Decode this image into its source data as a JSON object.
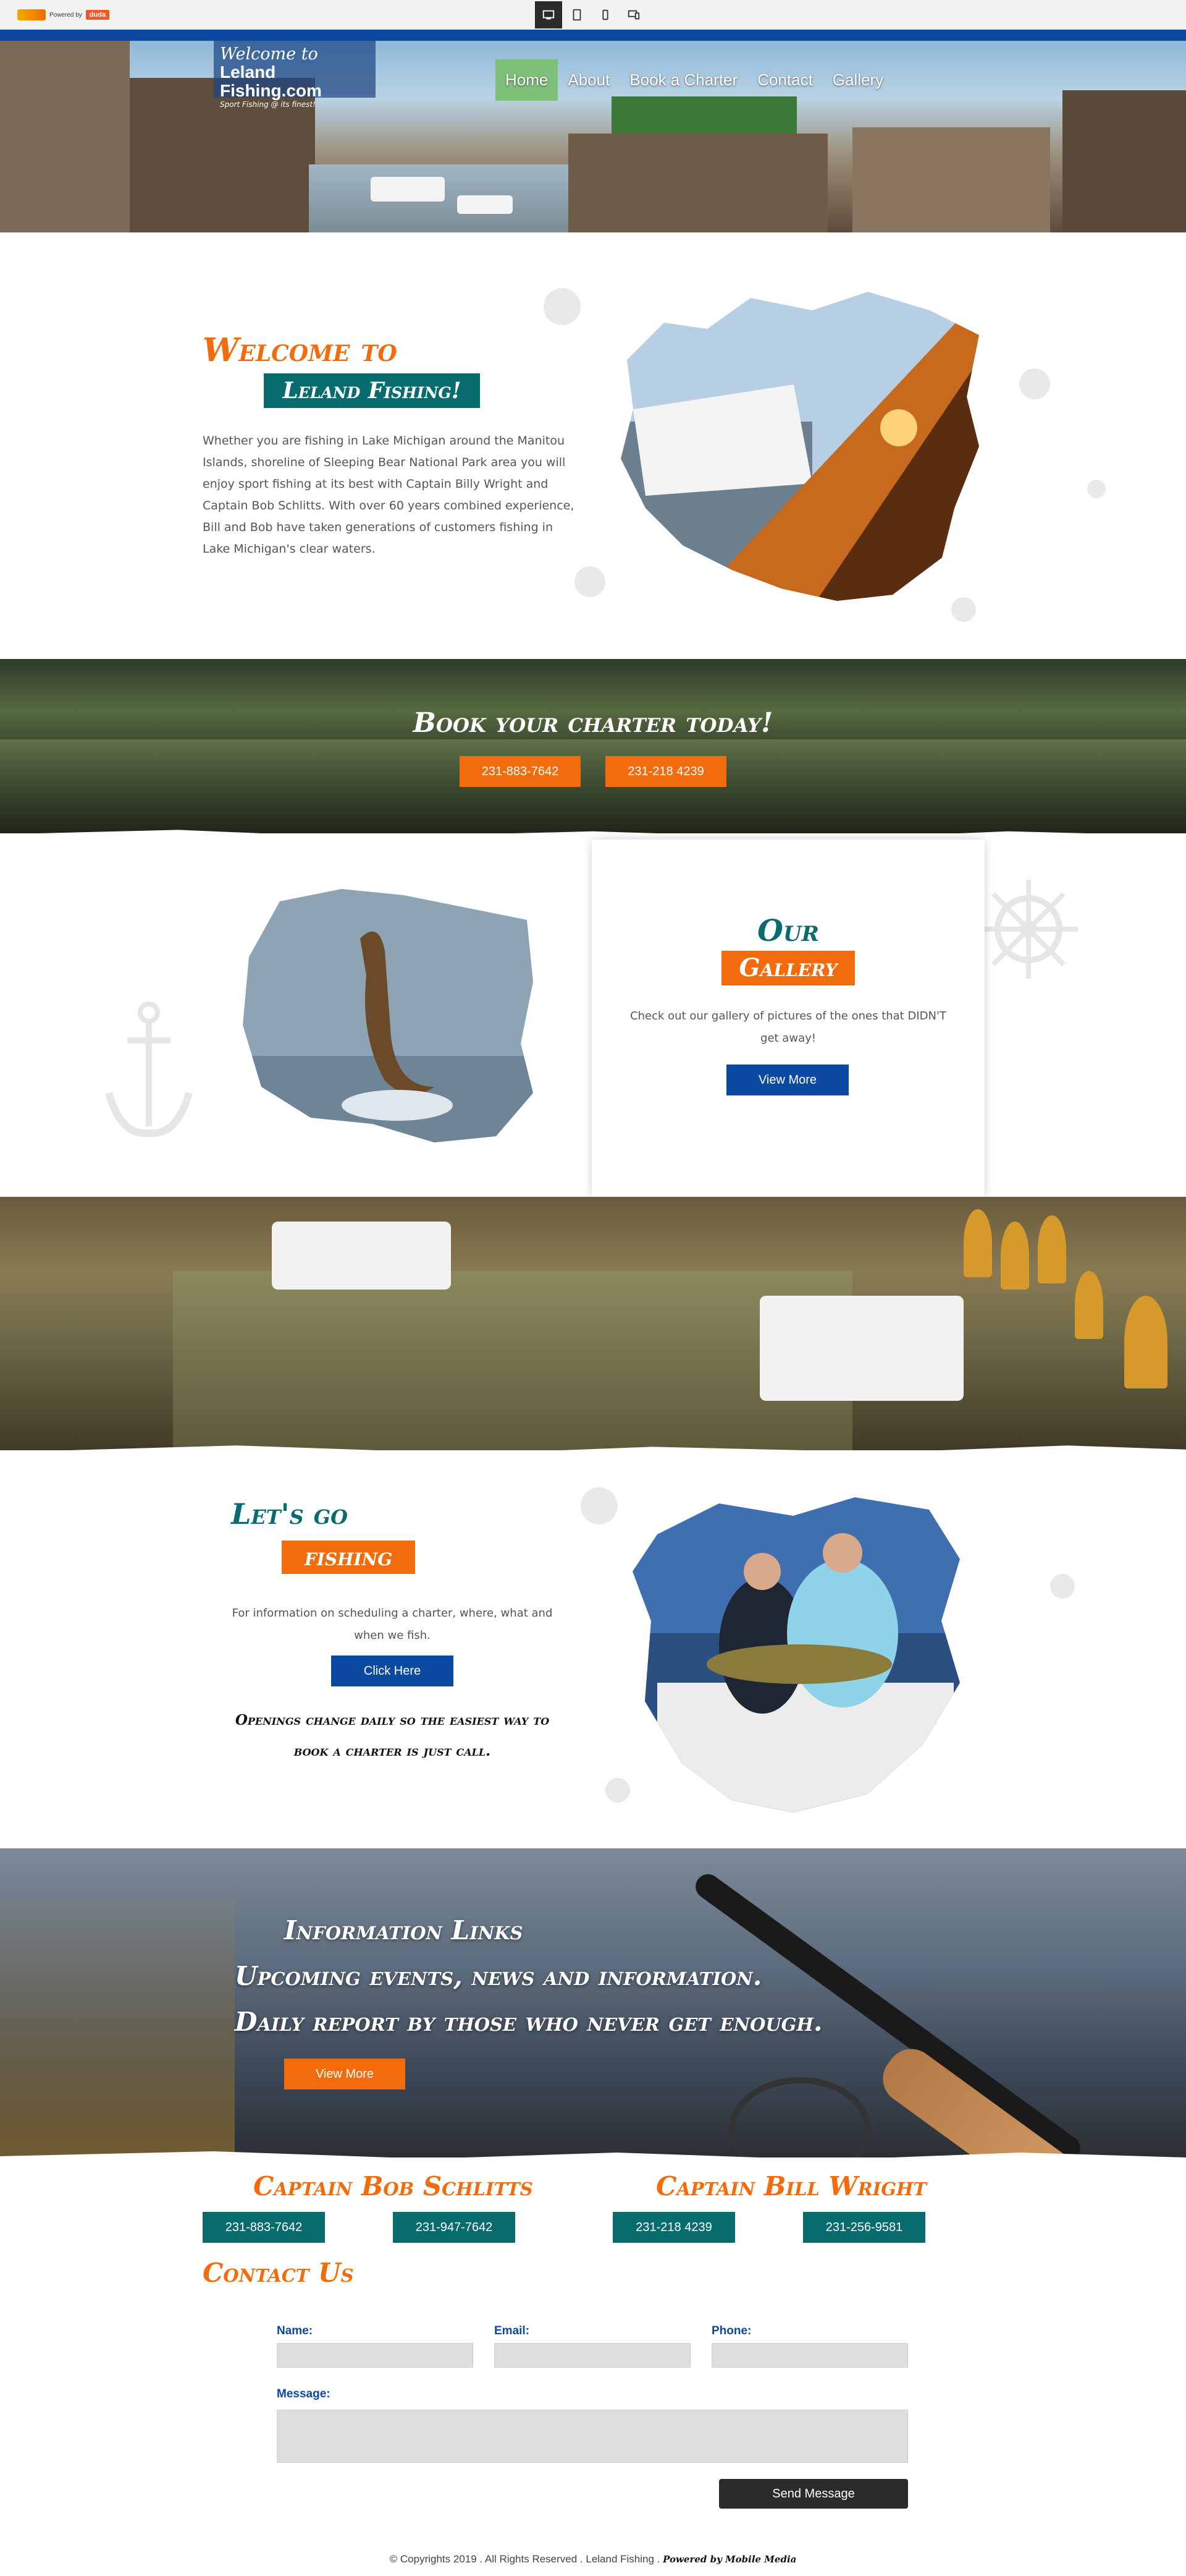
{
  "editor_bar": {
    "brand_text": "Powered by",
    "duda_label": "duda",
    "devices": [
      "desktop-icon",
      "tablet-icon",
      "mobile-icon",
      "responsive-icon"
    ]
  },
  "site": {
    "logo_line1": "Welcome to",
    "logo_line2": "Leland Fishing.com",
    "logo_line3": "Sport Fishing @ its finest!"
  },
  "nav": {
    "items": [
      "Home",
      "About",
      "Book a Charter",
      "Contact",
      "Gallery"
    ],
    "active": "Home"
  },
  "welcome": {
    "title1": "Welcome to",
    "title2": "Leland Fishing!",
    "body": "Whether you are fishing in Lake Michigan around the Manitou Islands, shoreline of Sleeping Bear National Park area you will enjoy sport fishing at its best with Captain Billy Wright and Captain Bob Schlitts. With over 60 years combined experience, Bill and Bob have taken generations of customers fishing in Lake Michigan's clear waters."
  },
  "book": {
    "title": "Book your charter today!",
    "phone1": "231-883-7642",
    "phone2": "231-218 4239"
  },
  "gallery": {
    "our": "Our",
    "gallery": "Gallery",
    "body": "Check out our gallery of pictures of the ones that DIDN'T get away!",
    "button": "View More"
  },
  "letsgo": {
    "title1": "Let's go",
    "title2": "fishing",
    "body": "For information on scheduling a charter, where, what and when we fish.",
    "button": "Click Here",
    "note": "Openings change daily so the easiest way to book a charter is just call."
  },
  "info": {
    "line1": "Information Links",
    "line2": "Upcoming events, news and information.",
    "line3": "Daily report by those who never get enough.",
    "button": "View More"
  },
  "captains": {
    "bob": {
      "name": "Captain Bob Schlitts",
      "phone1": "231-883-7642",
      "phone2": "231-947-7642"
    },
    "bill": {
      "name": "Captain Bill Wright",
      "phone1": "231-218 4239",
      "phone2": "231-256-9581"
    }
  },
  "contact": {
    "title": "Contact Us",
    "name_label": "Name:",
    "email_label": "Email:",
    "phone_label": "Phone:",
    "message_label": "Message:",
    "send": "Send Message"
  },
  "footer": {
    "copyright": "© Copyrights 2019 . All Rights Reserved . Leland Fishing .",
    "powered": "Powered by Mobile Media"
  },
  "colors": {
    "orange": "#f26c0d",
    "teal": "#086b6e",
    "blue": "#0b4aa0",
    "nav_active": "#7ec07a"
  }
}
